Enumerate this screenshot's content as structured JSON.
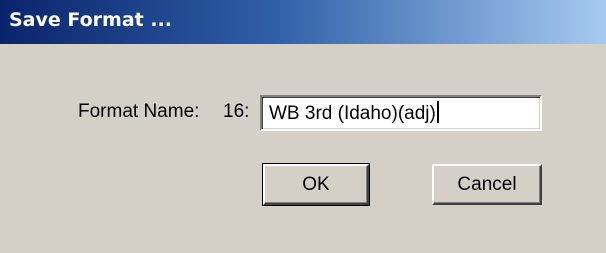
{
  "window": {
    "title": "Save Format ..."
  },
  "form": {
    "label": "Format Name:",
    "format_number": "16:",
    "format_name_value": "WB 3rd (Idaho)(adj)"
  },
  "buttons": {
    "ok_label": "OK",
    "cancel_label": "Cancel"
  },
  "colors": {
    "dialog_background": "#d4d0c8",
    "title_bar_start": "#0a246a",
    "title_bar_end": "#a6caf0",
    "title_text": "#ffffff"
  }
}
